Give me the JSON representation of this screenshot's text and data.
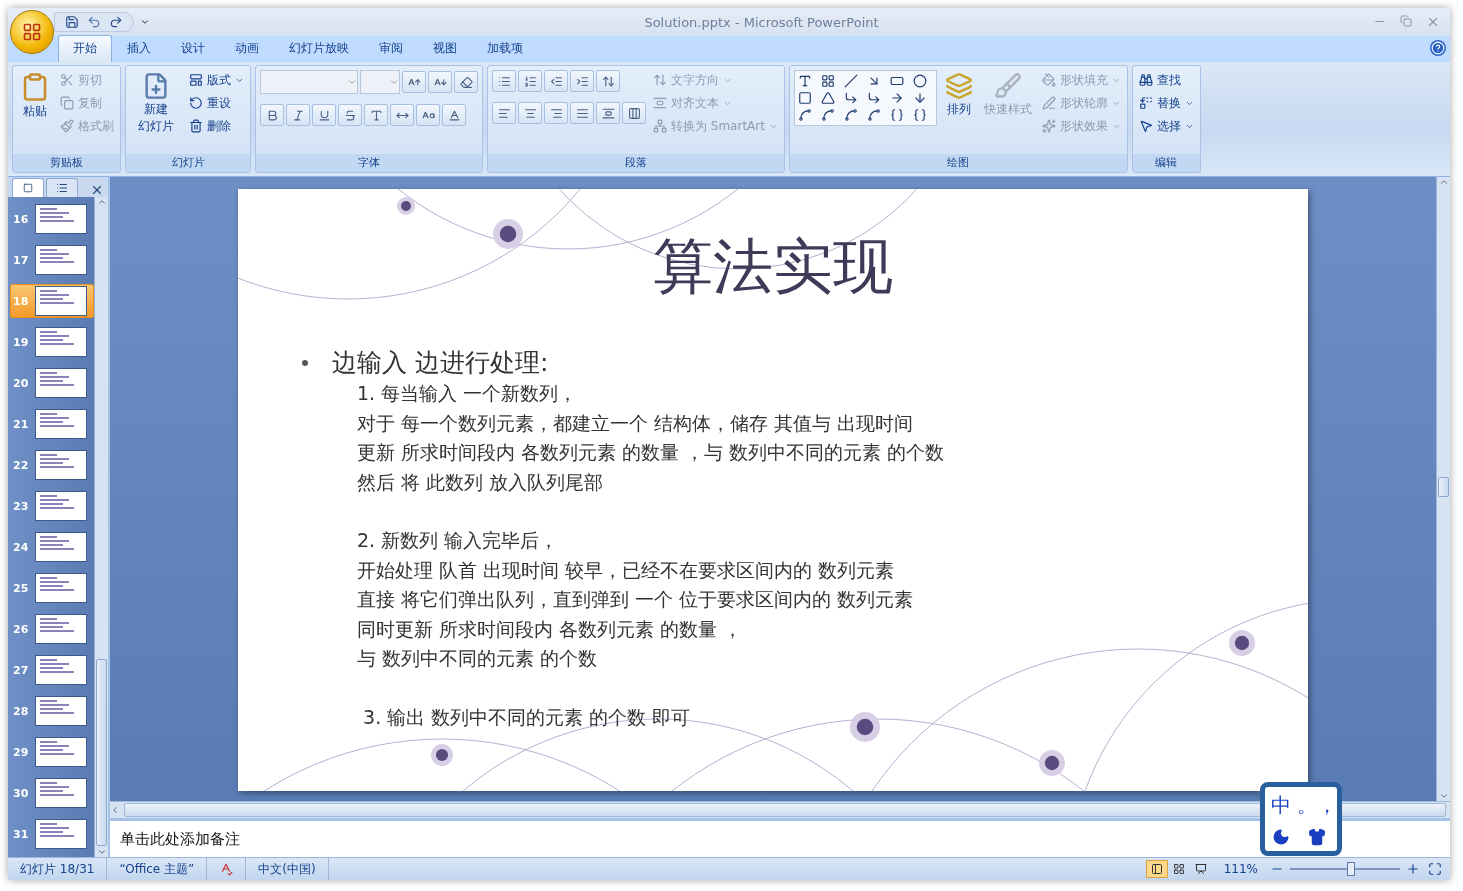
{
  "window": {
    "title": "Solution.pptx - Microsoft PowerPoint"
  },
  "tabs": [
    {
      "label": "开始",
      "selected": true
    },
    {
      "label": "插入",
      "selected": false
    },
    {
      "label": "设计",
      "selected": false
    },
    {
      "label": "动画",
      "selected": false
    },
    {
      "label": "幻灯片放映",
      "selected": false
    },
    {
      "label": "审阅",
      "selected": false
    },
    {
      "label": "视图",
      "selected": false
    },
    {
      "label": "加载项",
      "selected": false
    }
  ],
  "ribbon": {
    "clipboard": {
      "title": "剪贴板",
      "large": {
        "label": "粘贴",
        "disabled": false
      },
      "items": [
        {
          "label": "剪切",
          "disabled": true
        },
        {
          "label": "复制",
          "disabled": true
        },
        {
          "label": "格式刷",
          "disabled": true
        }
      ]
    },
    "slides": {
      "title": "幻灯片",
      "large": {
        "label_lines": [
          "新建",
          "幻灯片"
        ],
        "disabled": false
      },
      "items": [
        {
          "label": "版式",
          "disabled": false
        },
        {
          "label": "重设",
          "disabled": false
        },
        {
          "label": "删除",
          "disabled": false
        }
      ]
    },
    "font": {
      "title": "字体"
    },
    "paragraph": {
      "title": "段落",
      "items": [
        {
          "label": "文字方向",
          "disabled": true
        },
        {
          "label": "对齐文本",
          "disabled": true
        },
        {
          "label": "转换为 SmartArt",
          "disabled": true
        }
      ]
    },
    "drawing": {
      "title": "绘图",
      "arrange": {
        "label": "排列",
        "disabled": false
      },
      "quick_styles": {
        "label": "快速样式",
        "disabled": true
      },
      "items": [
        {
          "label": "形状填充",
          "disabled": true
        },
        {
          "label": "形状轮廓",
          "disabled": true
        },
        {
          "label": "形状效果",
          "disabled": true
        }
      ]
    },
    "editing": {
      "title": "编辑",
      "items": [
        {
          "label": "查找",
          "disabled": false
        },
        {
          "label": "替换",
          "disabled": false
        },
        {
          "label": "选择",
          "disabled": false
        }
      ]
    }
  },
  "slide_panel": {
    "thumbnails": [
      {
        "number": "16",
        "selected": false
      },
      {
        "number": "17",
        "selected": false
      },
      {
        "number": "18",
        "selected": true
      },
      {
        "number": "19",
        "selected": false
      },
      {
        "number": "20",
        "selected": false
      },
      {
        "number": "21",
        "selected": false
      },
      {
        "number": "22",
        "selected": false
      },
      {
        "number": "23",
        "selected": false
      },
      {
        "number": "24",
        "selected": false
      },
      {
        "number": "25",
        "selected": false
      },
      {
        "number": "26",
        "selected": false
      },
      {
        "number": "27",
        "selected": false
      },
      {
        "number": "28",
        "selected": false
      },
      {
        "number": "29",
        "selected": false
      },
      {
        "number": "30",
        "selected": false
      },
      {
        "number": "31",
        "selected": false
      }
    ]
  },
  "slide": {
    "title": "算法实现",
    "bullet": "边输入 边进行处理:",
    "paragraphs": [
      {
        "lines": [
          "1. 每当输入 一个新数列，",
          "对于 每一个数列元素，都建立一个 结构体，储存 其值与 出现时间",
          "更新 所求时间段内 各数列元素 的数量 ，与 数列中不同的元素 的个数",
          "然后 将 此数列 放入队列尾部"
        ]
      },
      {
        "lines": [
          "2. 新数列 输入完毕后，",
          "开始处理 队首 出现时间 较早，已经不在要求区间内的 数列元素",
          "直接 将它们弹出队列，直到弹到 一个 位于要求区间内的 数列元素",
          "同时更新 所求时间段内 各数列元素 的数量 ，",
          "与 数列中不同的元素 的个数"
        ]
      },
      {
        "lines": [
          " 3. 输出 数列中不同的元素 的个数 即可"
        ]
      }
    ]
  },
  "notes": {
    "placeholder": "单击此处添加备注"
  },
  "status_bar": {
    "slide": "幻灯片 18/31",
    "theme": "“Office 主题”",
    "language": "中文(中国)",
    "views": [
      {
        "selected": true
      },
      {
        "selected": false
      },
      {
        "selected": false
      }
    ],
    "zoom": "111%",
    "zoom_slider": {
      "level": 0.55
    }
  },
  "ime": {
    "mode": "中",
    "punctuation": "。，"
  }
}
